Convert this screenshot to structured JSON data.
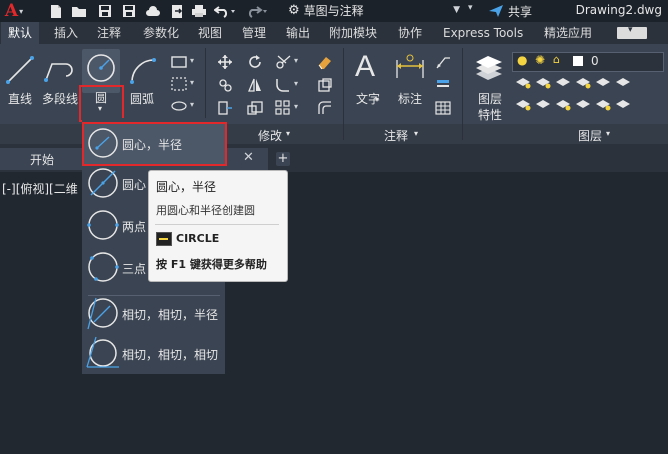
{
  "titlebar": {
    "app_logo": "A",
    "workspace": "草图与注释",
    "share": "共享",
    "file_name": "Drawing2.dwg"
  },
  "ribbon_tabs": [
    {
      "label": "默认",
      "active": true
    },
    {
      "label": "插入"
    },
    {
      "label": "注释"
    },
    {
      "label": "参数化"
    },
    {
      "label": "视图"
    },
    {
      "label": "管理"
    },
    {
      "label": "输出"
    },
    {
      "label": "附加模块"
    },
    {
      "label": "协作"
    },
    {
      "label": "Express Tools"
    },
    {
      "label": "精选应用"
    }
  ],
  "draw_panel": {
    "line": "直线",
    "polyline": "多段线",
    "circle": "圆",
    "arc": "圆弧"
  },
  "modify_panel": {
    "title": "修改"
  },
  "annotation_panel": {
    "text": "文字",
    "dimension": "标注",
    "title": "注释"
  },
  "layers_panel": {
    "layer_properties_line1": "图层",
    "layer_properties_line2": "特性",
    "current_layer": "0",
    "title": "图层"
  },
  "doc_tab": {
    "label": "开始"
  },
  "viewport": {
    "label": "[-][俯视][二维"
  },
  "circle_dropdown": [
    {
      "label": "圆心，半径",
      "highlighted": true
    },
    {
      "label": "圆心"
    },
    {
      "label": "两点"
    },
    {
      "label": "三点"
    },
    {
      "label": "相切，相切，半径"
    },
    {
      "label": "相切，相切，相切"
    }
  ],
  "tooltip": {
    "title": "圆心，半径",
    "description": "用圆心和半径创建圆",
    "command": "CIRCLE",
    "help": "按 F1 键获得更多帮助"
  },
  "colors": {
    "highlight_border": "#e2282a",
    "accent_blue": "#4aa3e8",
    "ribbon_bg": "#3b4452",
    "canvas_bg": "#212830"
  }
}
